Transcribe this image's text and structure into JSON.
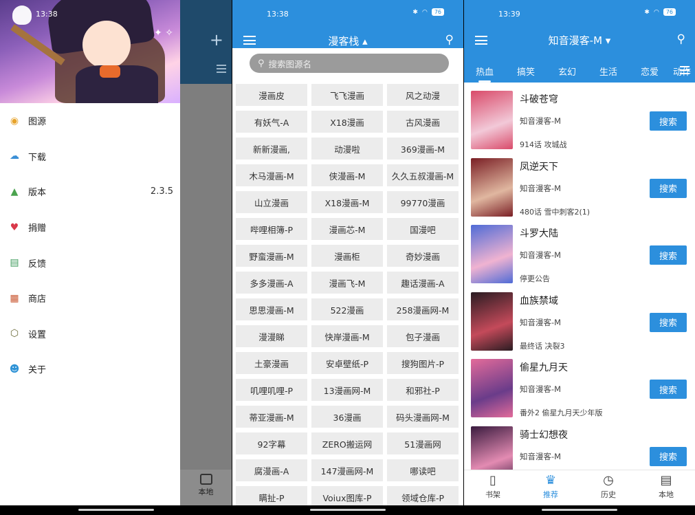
{
  "screen1": {
    "status_time": "13:38",
    "behind_local_label": "本地",
    "version_value": "2.3.5",
    "menu": [
      {
        "label": "图源",
        "icon": "source-icon"
      },
      {
        "label": "下载",
        "icon": "cloud-download-icon"
      },
      {
        "label": "版本",
        "icon": "rocket-icon"
      },
      {
        "label": "捐赠",
        "icon": "heart-icon"
      },
      {
        "label": "反馈",
        "icon": "feedback-icon"
      },
      {
        "label": "商店",
        "icon": "store-icon"
      },
      {
        "label": "设置",
        "icon": "settings-icon"
      },
      {
        "label": "关于",
        "icon": "robot-icon"
      }
    ]
  },
  "screen2": {
    "status_time": "13:38",
    "battery": "76",
    "title": "漫客栈 ▴",
    "search_placeholder": "搜索图源名",
    "sources": [
      "漫画皮",
      "飞飞漫画",
      "风之动漫",
      "有妖气-A",
      "X18漫画",
      "古风漫画",
      "新新漫画,",
      "动漫啦",
      "369漫画-M",
      "木马漫画-M",
      "侠漫画-M",
      "久久五叔漫画-M",
      "山立漫画",
      "X18漫画-M",
      "99770漫画",
      "哔哩相簿-P",
      "漫画芯-M",
      "国漫吧",
      "野蛮漫画-M",
      "漫画柜",
      "奇妙漫画",
      "多多漫画-A",
      "漫画飞-M",
      "趣话漫画-A",
      "思思漫画-M",
      "522漫画",
      "258漫画网-M",
      "漫漫睇",
      "快岸漫画-M",
      "包子漫画",
      "土豪漫画",
      "安卓壁纸-P",
      "搜狗图片-P",
      "叽哩叽哩-P",
      "13漫画网-M",
      "和邪社-P",
      "蒂亚漫画-M",
      "36漫画",
      "码头漫画网-M",
      "92字幕",
      "ZERO搬运网",
      "51漫画网",
      "腐漫画-A",
      "147漫画网-M",
      "哪读吧",
      "瞒扯-P",
      "Voiux图库-P",
      "领域仓库-P"
    ]
  },
  "screen3": {
    "status_time": "13:39",
    "battery": "76",
    "title": "知音漫客-M ▾",
    "tabs": [
      "热血",
      "搞笑",
      "玄幻",
      "生活",
      "恋爱",
      "动作"
    ],
    "search_button_label": "搜索",
    "comics": [
      {
        "name": "斗破苍穹",
        "source": "知音漫客-M",
        "episode": "914话 攻城战",
        "color1": "#d94b6a",
        "color2": "#f2c9d8"
      },
      {
        "name": "凤逆天下",
        "source": "知音漫客-M",
        "episode": "480话 雪中刺客2(1)",
        "color1": "#7a1f25",
        "color2": "#e0b7a0"
      },
      {
        "name": "斗罗大陆",
        "source": "知音漫客-M",
        "episode": "停更公告",
        "color1": "#4f6bd6",
        "color2": "#f0b3d1"
      },
      {
        "name": "血族禁域",
        "source": "知音漫客-M",
        "episode": "最终话 决裂3",
        "color1": "#2a1c22",
        "color2": "#c44a5a"
      },
      {
        "name": "偷星九月天",
        "source": "知音漫客-M",
        "episode": "番外2 偷星九月天少年版",
        "color1": "#e36b9a",
        "color2": "#6a3c8a"
      },
      {
        "name": "骑士幻想夜",
        "source": "知音漫客-M",
        "episode": "",
        "color1": "#3a1b3f",
        "color2": "#e38bb2"
      }
    ],
    "bottom_nav": [
      {
        "label": "书架",
        "icon": "bookshelf-icon",
        "glyph": "▯"
      },
      {
        "label": "推荐",
        "icon": "recommend-icon",
        "glyph": "♛"
      },
      {
        "label": "历史",
        "icon": "history-icon",
        "glyph": "◷"
      },
      {
        "label": "本地",
        "icon": "local-store-icon",
        "glyph": "▤"
      }
    ]
  }
}
